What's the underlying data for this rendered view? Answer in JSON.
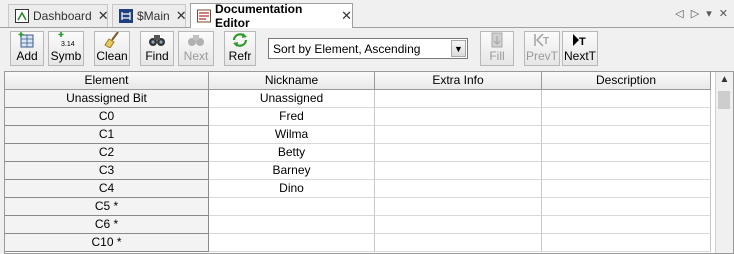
{
  "tabs": [
    {
      "label": "Dashboard",
      "icon": "dashboard-icon",
      "active": false
    },
    {
      "label": "$Main",
      "icon": "ladder-program-icon",
      "active": false
    },
    {
      "label": "Documentation Editor",
      "icon": "documentation-editor-icon",
      "active": true
    }
  ],
  "tab_close_glyph": "✕",
  "tab_controls": "◁ ▷ ▾ ✕",
  "toolbar": {
    "add": "Add",
    "symb": "Symb",
    "clean": "Clean",
    "find": "Find",
    "next": "Next",
    "refr": "Refr",
    "sort_selected": "Sort by Element, Ascending",
    "fill": "Fill",
    "prevt": "PrevT",
    "nextt": "NextT"
  },
  "table": {
    "columns": [
      "Element",
      "Nickname",
      "Extra Info",
      "Description"
    ],
    "rows": [
      [
        "Unassigned Bit",
        "Unassigned",
        "",
        ""
      ],
      [
        "C0",
        "Fred",
        "",
        ""
      ],
      [
        "C1",
        "Wilma",
        "",
        ""
      ],
      [
        "C2",
        "Betty",
        "",
        ""
      ],
      [
        "C3",
        "Barney",
        "",
        ""
      ],
      [
        "C4",
        "Dino",
        "",
        ""
      ],
      [
        "C5 *",
        "",
        "",
        ""
      ],
      [
        "C6 *",
        "",
        "",
        ""
      ],
      [
        "C10 *",
        "",
        "",
        ""
      ]
    ]
  },
  "colors": {
    "accent_green": "#3a9a3a",
    "header_bg": "#e9e9e9",
    "element_col_bg": "#f3f3f3"
  }
}
